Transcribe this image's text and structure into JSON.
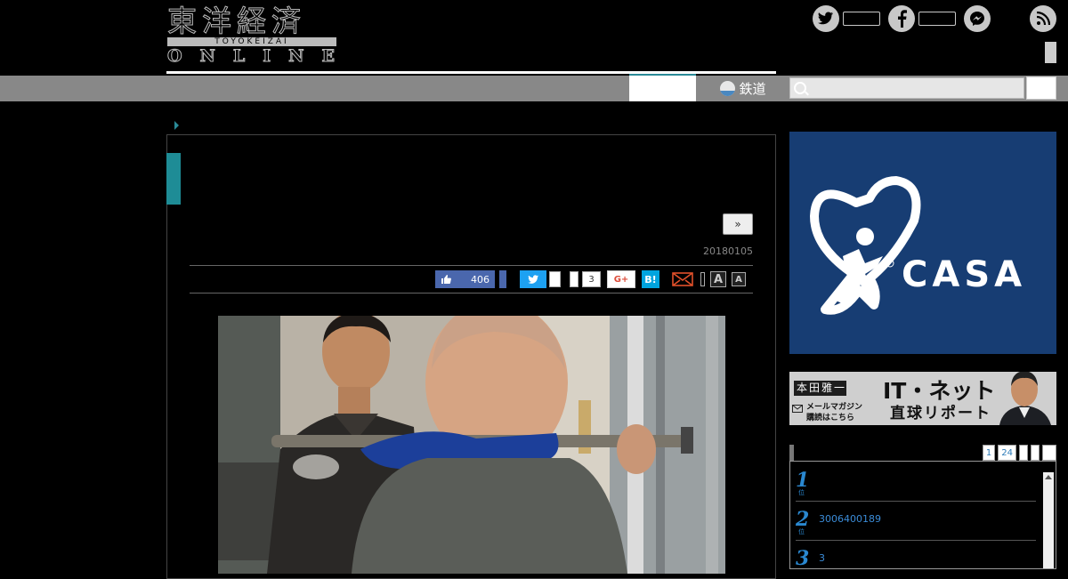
{
  "logo": {
    "kanji": "東洋経済",
    "romaji": "TOYOKEIZAI",
    "online": "ONLINE"
  },
  "social": [
    {
      "name": "twitter-icon",
      "glyph": "t"
    },
    {
      "name": "facebook-icon",
      "glyph": "f"
    },
    {
      "name": "messenger-icon",
      "glyph": "~"
    },
    {
      "name": "rss-icon",
      "glyph": "))"
    }
  ],
  "nav": {
    "rail_label": "鉄道"
  },
  "article": {
    "next_label": "»",
    "date": "20180105",
    "share": {
      "like_count": "406",
      "line_count": "3",
      "gplus_label": "G+",
      "hatena_label": "B!",
      "font_large": "A",
      "font_small": "A"
    }
  },
  "sidebar": {
    "casa_label": "CASA",
    "honda": {
      "name": "本田雅一",
      "mail": "メールマガジン",
      "mail_sub": "購読はこちら",
      "title": "IT・ネット",
      "subtitle": "直球リポート"
    },
    "ranking": {
      "tabs": [
        "1",
        "24"
      ],
      "items": [
        {
          "rank": "1",
          "suffix": "位",
          "text": ""
        },
        {
          "rank": "2",
          "suffix": "位",
          "text": "3006400189"
        },
        {
          "rank": "3",
          "suffix": "位",
          "text": "3"
        }
      ]
    }
  },
  "colors": {
    "accent_teal": "#1e8c96",
    "nav_gray": "#888888",
    "casa_blue": "#173d73",
    "facebook": "#4a67ad",
    "twitter": "#1da1f2",
    "hatena": "#00a4de"
  }
}
